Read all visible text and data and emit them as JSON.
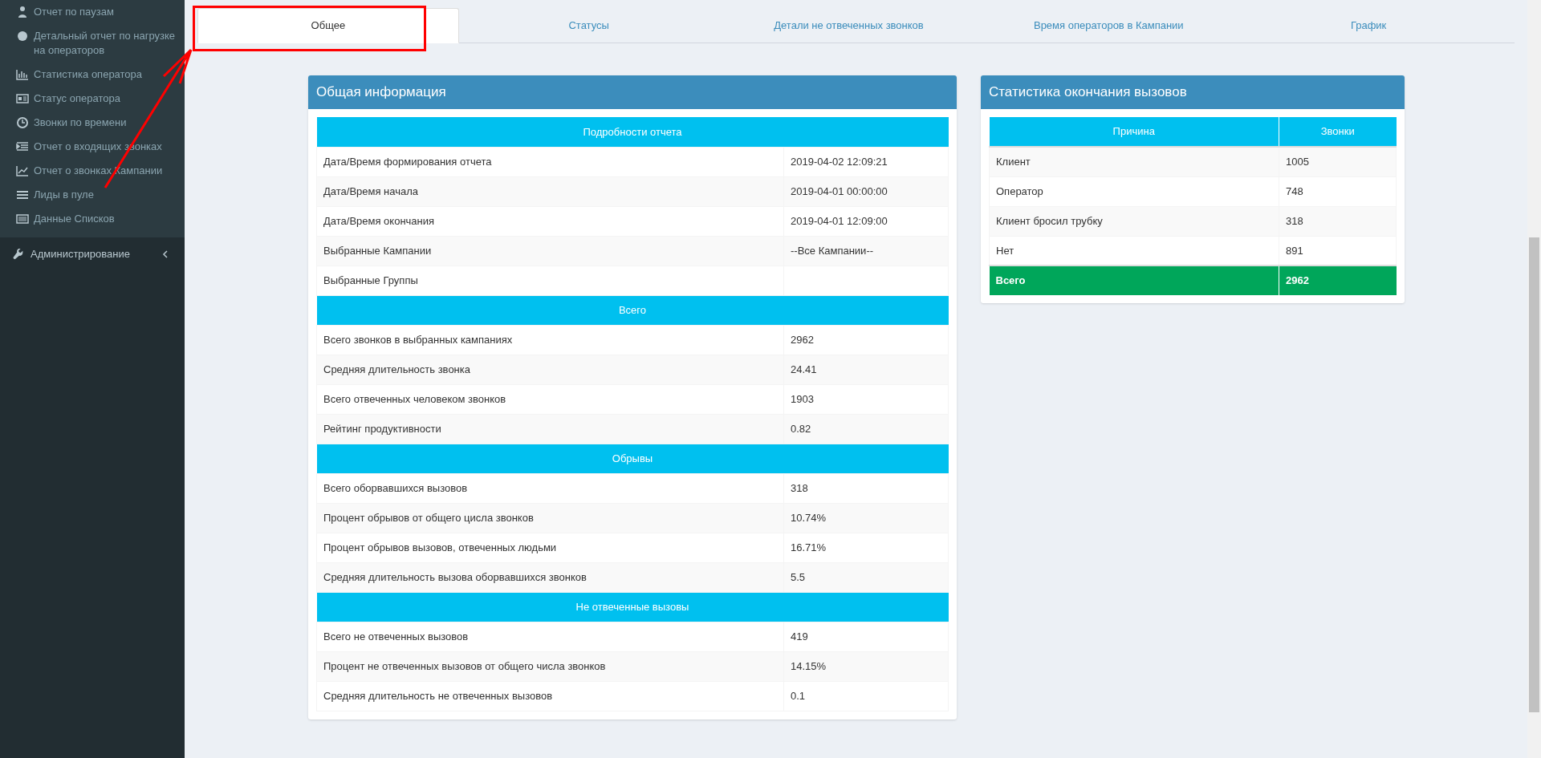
{
  "sidebar": {
    "items": [
      {
        "label": "Отчет по паузам"
      },
      {
        "label": "Детальный отчет по нагрузке на операторов"
      },
      {
        "label": "Статистика оператора"
      },
      {
        "label": "Статус оператора"
      },
      {
        "label": "Звонки по времени"
      },
      {
        "label": "Отчет о входящих звонках"
      },
      {
        "label": "Отчет о звонках Кампании"
      },
      {
        "label": "Лиды в пуле"
      },
      {
        "label": "Данные Списков"
      }
    ],
    "section": {
      "label": "Администрирование",
      "expanded": false
    }
  },
  "tabs": [
    {
      "label": "Общее",
      "selected": true
    },
    {
      "label": "Статусы",
      "selected": false
    },
    {
      "label": "Детали не отвеченных звонков",
      "selected": false
    },
    {
      "label": "Время операторов в Кампании",
      "selected": false
    },
    {
      "label": "График",
      "selected": false
    }
  ],
  "general_panel": {
    "title": "Общая информация",
    "sections": [
      {
        "heading": "Подробности отчета",
        "rows": [
          [
            "Дата/Время формирования отчета",
            "2019-04-02 12:09:21"
          ],
          [
            "Дата/Время начала",
            "2019-04-01 00:00:00"
          ],
          [
            "Дата/Время окончания",
            "2019-04-01 12:09:00"
          ],
          [
            "Выбранные Кампании",
            "--Все Кампании--"
          ],
          [
            "Выбранные Группы",
            ""
          ]
        ]
      },
      {
        "heading": "Всего",
        "rows": [
          [
            "Всего звонков в выбранных кампаниях",
            "2962"
          ],
          [
            "Средняя длительность звонка",
            "24.41"
          ],
          [
            "Всего отвеченных человеком звонков",
            "1903"
          ],
          [
            "Рейтинг продуктивности",
            "0.82"
          ]
        ]
      },
      {
        "heading": "Обрывы",
        "rows": [
          [
            "Всего оборвавшихся вызовов",
            "318"
          ],
          [
            "Процент обрывов от общего цисла звонков",
            "10.74%"
          ],
          [
            "Процент обрывов вызовов, отвеченных людьми",
            "16.71%"
          ],
          [
            "Средняя длительность вызова оборвавшихся звонков",
            "5.5"
          ]
        ]
      },
      {
        "heading": "Не отвеченные вызовы",
        "rows": [
          [
            "Всего не отвеченных вызовов",
            "419"
          ],
          [
            "Процент не отвеченных вызовов от общего числа звонков",
            "14.15%"
          ],
          [
            "Средняя длительность не отвеченных вызовов",
            "0.1"
          ]
        ]
      }
    ]
  },
  "end_stats_panel": {
    "title": "Статистика окончания вызовов",
    "columns": [
      "Причина",
      "Звонки"
    ],
    "rows": [
      [
        "Клиент",
        "1005"
      ],
      [
        "Оператор",
        "748"
      ],
      [
        "Клиент бросил трубку",
        "318"
      ],
      [
        "Нет",
        "891"
      ]
    ],
    "total": [
      "Всего",
      "2962"
    ]
  }
}
